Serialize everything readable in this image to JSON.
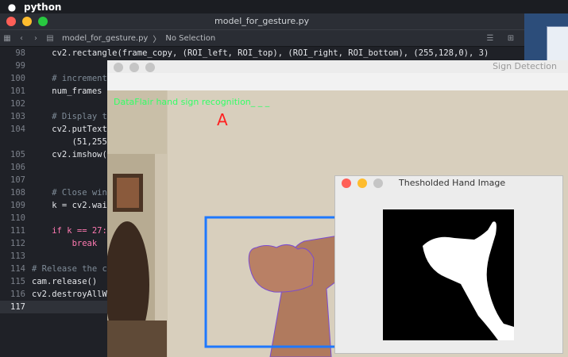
{
  "menubar": {
    "apple": "",
    "app": "python"
  },
  "editor": {
    "title": "model_for_gesture.py",
    "breadcrumb": {
      "file": "model_for_gesture.py",
      "sep": "〉",
      "selection": "No Selection"
    },
    "lines": [
      {
        "n": "98",
        "text": "    cv2.rectangle(frame_copy, (ROI_left, ROI_top), (ROI_right, ROI_bottom), (255,128,0), 3)",
        "current": false
      },
      {
        "n": "99",
        "text": "",
        "current": false
      },
      {
        "n": "100",
        "text": "    # increment",
        "current": false
      },
      {
        "n": "101",
        "text": "    num_frames",
        "current": false
      },
      {
        "n": "102",
        "text": "",
        "current": false
      },
      {
        "n": "103",
        "text": "    # Display t",
        "current": false
      },
      {
        "n": "104",
        "text": "    cv2.putText",
        "current": false
      },
      {
        "n": "",
        "text": "        (51,255",
        "current": false
      },
      {
        "n": "105",
        "text": "    cv2.imshow(",
        "current": false
      },
      {
        "n": "106",
        "text": "",
        "current": false
      },
      {
        "n": "107",
        "text": "",
        "current": false
      },
      {
        "n": "108",
        "text": "    # Close win",
        "current": false
      },
      {
        "n": "109",
        "text": "    k = cv2.wai",
        "current": false
      },
      {
        "n": "110",
        "text": "",
        "current": false
      },
      {
        "n": "111",
        "text": "    if k == 27:",
        "current": false
      },
      {
        "n": "112",
        "text": "        break",
        "current": false
      },
      {
        "n": "113",
        "text": "",
        "current": false
      },
      {
        "n": "114",
        "text": "# Release the c",
        "current": false
      },
      {
        "n": "115",
        "text": "cam.release()",
        "current": false
      },
      {
        "n": "116",
        "text": "cv2.destroyAllW",
        "current": false
      },
      {
        "n": "117",
        "text": "",
        "current": true
      }
    ]
  },
  "sign_window": {
    "title": "Sign Detection",
    "overlay_text": "DataFlair hand sign recognition_ _ _",
    "prediction": "A"
  },
  "threshold_window": {
    "title": "Thesholded Hand Image"
  },
  "colors": {
    "overlay_text": "#33ff66",
    "prediction": "#ff2020",
    "roi_box": "#1e78ff"
  }
}
